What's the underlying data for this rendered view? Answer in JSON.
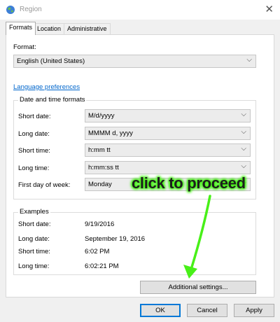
{
  "window": {
    "title": "Region"
  },
  "tabs": [
    {
      "label": "Formats",
      "active": true
    },
    {
      "label": "Location",
      "active": false
    },
    {
      "label": "Administrative",
      "active": false
    }
  ],
  "format": {
    "label": "Format:",
    "value": "English (United States)"
  },
  "language_link": "Language preferences",
  "datetime_group": {
    "title": "Date and time formats",
    "rows": [
      {
        "label": "Short date:",
        "value": "M/d/yyyy"
      },
      {
        "label": "Long date:",
        "value": "MMMM d, yyyy"
      },
      {
        "label": "Short time:",
        "value": "h:mm tt"
      },
      {
        "label": "Long time:",
        "value": "h:mm:ss tt"
      },
      {
        "label": "First day of week:",
        "value": "Monday"
      }
    ]
  },
  "examples": {
    "title": "Examples",
    "rows": [
      {
        "label": "Short date:",
        "value": "9/19/2016"
      },
      {
        "label": "Long date:",
        "value": "September 19, 2016"
      },
      {
        "label": "Short time:",
        "value": "6:02 PM"
      },
      {
        "label": "Long time:",
        "value": "6:02:21 PM"
      }
    ]
  },
  "additional_settings_button": "Additional settings...",
  "footer": {
    "ok": "OK",
    "cancel": "Cancel",
    "apply": "Apply"
  },
  "annotation": {
    "text": "click to proceed",
    "color": "#48f018"
  },
  "icons": {
    "app": "globe-icon",
    "close": "close-icon",
    "dropdown": "chevron-down-icon"
  }
}
